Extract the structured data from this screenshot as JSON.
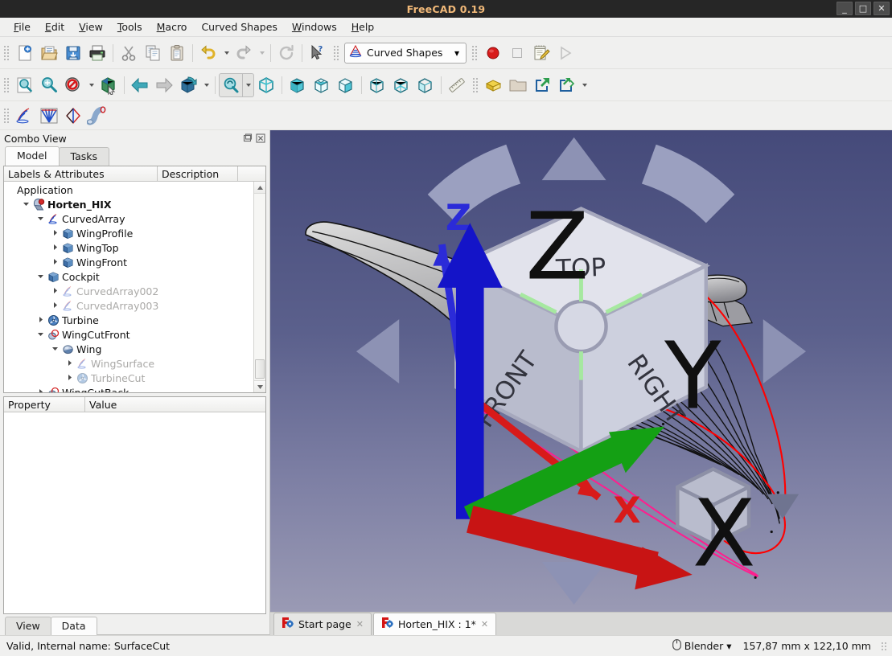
{
  "window": {
    "title": "FreeCAD 0.19",
    "minimize": "_",
    "maximize": "□",
    "close": "✕"
  },
  "menubar": {
    "items": [
      {
        "label": "File",
        "accel": "F"
      },
      {
        "label": "Edit",
        "accel": "E"
      },
      {
        "label": "View",
        "accel": "V"
      },
      {
        "label": "Tools",
        "accel": "T"
      },
      {
        "label": "Macro",
        "accel": "M"
      },
      {
        "label": "Curved Shapes",
        "accel": ""
      },
      {
        "label": "Windows",
        "accel": "W"
      },
      {
        "label": "Help",
        "accel": "H"
      }
    ]
  },
  "toolbars": {
    "file": [
      {
        "name": "new-document-icon",
        "title": "New"
      },
      {
        "name": "open-document-icon",
        "title": "Open"
      },
      {
        "name": "save-document-icon",
        "title": "Save"
      },
      {
        "name": "print-icon",
        "title": "Print"
      },
      {
        "name": "cut-icon",
        "title": "Cut"
      },
      {
        "name": "copy-icon",
        "title": "Copy"
      },
      {
        "name": "paste-icon",
        "title": "Paste"
      },
      {
        "name": "undo-icon",
        "title": "Undo"
      },
      {
        "name": "redo-icon",
        "title": "Redo"
      },
      {
        "name": "refresh-icon",
        "title": "Refresh"
      },
      {
        "name": "whats-this-icon",
        "title": "What's This"
      }
    ],
    "workbench": {
      "selected": "Curved Shapes",
      "arrow": "▾",
      "icon": "curved-shapes-workbench-icon"
    },
    "macro": [
      {
        "name": "macro-record-icon",
        "title": "Macro recording"
      },
      {
        "name": "macro-stop-icon",
        "title": "Stop macro recording"
      },
      {
        "name": "macro-edit-icon",
        "title": "Macros"
      },
      {
        "name": "macro-execute-icon",
        "title": "Execute macro"
      }
    ],
    "view": [
      {
        "name": "fit-all-icon",
        "title": "Fit all"
      },
      {
        "name": "fit-selection-icon",
        "title": "Fit selection"
      },
      {
        "name": "draw-style-icon",
        "title": "Draw style"
      },
      {
        "name": "box-selection-icon",
        "title": "Box selection"
      },
      {
        "name": "back-arrow-icon",
        "title": "Back"
      },
      {
        "name": "forward-arrow-icon",
        "title": "Forward"
      },
      {
        "name": "std-views-icon",
        "title": "Standard views"
      },
      {
        "name": "zoom-icon",
        "title": "Zoom",
        "active": true
      },
      {
        "name": "axonometric-view-icon",
        "title": "Axonometric"
      },
      {
        "name": "front-view-icon",
        "title": "Front"
      },
      {
        "name": "top-view-icon",
        "title": "Top"
      },
      {
        "name": "right-view-icon",
        "title": "Right"
      },
      {
        "name": "rear-view-icon",
        "title": "Rear"
      },
      {
        "name": "bottom-view-icon",
        "title": "Bottom"
      },
      {
        "name": "left-view-icon",
        "title": "Left"
      },
      {
        "name": "measure-icon",
        "title": "Measure"
      },
      {
        "name": "part-box-icon",
        "title": "Create part"
      },
      {
        "name": "group-folder-icon",
        "title": "Create group"
      },
      {
        "name": "link-icon",
        "title": "Make link"
      },
      {
        "name": "link-group-icon",
        "title": "Make sub-link"
      }
    ],
    "curved_shapes": [
      {
        "name": "curved-array-icon",
        "title": "Curved array"
      },
      {
        "name": "interpolated-middle-icon",
        "title": "Interpolated middle surface"
      },
      {
        "name": "curved-segment-icon",
        "title": "Curved segment"
      },
      {
        "name": "sweep2rails-icon",
        "title": "Sweep 2 rails"
      }
    ]
  },
  "combo_view": {
    "title": "Combo View",
    "float_icon": "float-panel-icon",
    "close_icon": "close-panel-icon",
    "tabs": [
      {
        "label": "Model",
        "selected": true
      },
      {
        "label": "Tasks",
        "selected": false
      }
    ],
    "tree": {
      "columns": [
        "Labels & Attributes",
        "Description"
      ],
      "items": [
        {
          "label": "Application",
          "indent": 0,
          "twist": "",
          "icon": "",
          "dim": false,
          "bold": false
        },
        {
          "label": "Horten_HIX",
          "indent": 1,
          "twist": "down",
          "icon": "document-icon",
          "dim": false,
          "bold": true
        },
        {
          "label": "CurvedArray",
          "indent": 2,
          "twist": "down",
          "icon": "curved-array-icon",
          "dim": false,
          "bold": false
        },
        {
          "label": "WingProfile",
          "indent": 3,
          "twist": "right",
          "icon": "sketch-box-icon",
          "dim": false,
          "bold": false
        },
        {
          "label": "WingTop",
          "indent": 3,
          "twist": "right",
          "icon": "sketch-box-icon",
          "dim": false,
          "bold": false
        },
        {
          "label": "WingFront",
          "indent": 3,
          "twist": "right",
          "icon": "sketch-box-icon",
          "dim": false,
          "bold": false
        },
        {
          "label": "Cockpit",
          "indent": 2,
          "twist": "down",
          "icon": "sketch-box-icon",
          "dim": false,
          "bold": false
        },
        {
          "label": "CurvedArray002",
          "indent": 3,
          "twist": "right",
          "icon": "curved-array-icon",
          "dim": true,
          "bold": false
        },
        {
          "label": "CurvedArray003",
          "indent": 3,
          "twist": "right",
          "icon": "curved-array-icon",
          "dim": true,
          "bold": false
        },
        {
          "label": "Turbine",
          "indent": 2,
          "twist": "right",
          "icon": "turbine-icon",
          "dim": false,
          "bold": false
        },
        {
          "label": "WingCutFront",
          "indent": 2,
          "twist": "down",
          "icon": "cut-shape-icon",
          "dim": false,
          "bold": false
        },
        {
          "label": "Wing",
          "indent": 3,
          "twist": "down",
          "icon": "fuse-shape-icon",
          "dim": false,
          "bold": false
        },
        {
          "label": "WingSurface",
          "indent": 4,
          "twist": "right",
          "icon": "curved-array-icon",
          "dim": true,
          "bold": false
        },
        {
          "label": "TurbineCut",
          "indent": 4,
          "twist": "right",
          "icon": "turbine-icon",
          "dim": true,
          "bold": false
        },
        {
          "label": "WingCutBack",
          "indent": 2,
          "twist": "right",
          "icon": "cut-shape-icon",
          "dim": false,
          "bold": false
        }
      ],
      "scrollbar": {
        "up": "▲",
        "down": "▼"
      }
    },
    "property_editor": {
      "columns": [
        "Property",
        "Value"
      ],
      "rows": []
    },
    "bottom_tabs": [
      {
        "label": "View",
        "selected": false
      },
      {
        "label": "Data",
        "selected": true
      }
    ]
  },
  "viewport": {
    "nav_cube": {
      "top_face": "TOP",
      "left_face": "FRONT",
      "right_face": "RIGHT",
      "axis_z": "Z",
      "axis_x": "X",
      "menu_icon": "nav-cube-menu-icon"
    },
    "axis_cross": {
      "x": "X",
      "y": "Y",
      "z": "Z"
    },
    "colors": {
      "bg_top": "#454a7a",
      "bg_bottom": "#9a9ab4",
      "red_curve": "#ff0000",
      "orange_curve": "#ff7518",
      "magenta_curve": "#ff1e8e",
      "shape_light": "#d2d2d2",
      "shape_dark": "#6e6e72"
    }
  },
  "mdi_tabs": [
    {
      "label": "Start page",
      "selected": false,
      "icon": "freecad-logo-icon",
      "close": "✕"
    },
    {
      "label": "Horten_HIX : 1*",
      "selected": true,
      "icon": "freecad-logo-icon",
      "close": "✕"
    }
  ],
  "statusbar": {
    "message": "Valid, Internal name: SurfaceCut",
    "nav_style": "Blender",
    "nav_arrow": "▾",
    "nav_icon": "mouse-icon",
    "dimensions": "157,87 mm x 122,10 mm"
  }
}
